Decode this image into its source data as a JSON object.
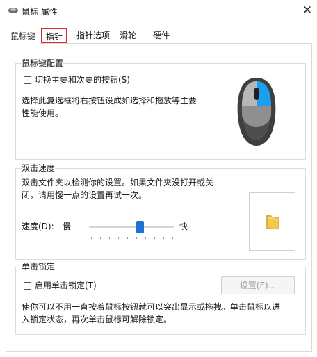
{
  "window": {
    "title": "鼠标 属性"
  },
  "tabs": [
    {
      "label": "鼠标键",
      "active": true
    },
    {
      "label": "指针",
      "highlighted": true
    },
    {
      "label": "指针选项"
    },
    {
      "label": "滑轮"
    },
    {
      "label": "硬件"
    }
  ],
  "button_config": {
    "title": "鼠标键配置",
    "switch_label": "切换主要和次要的按钮(S)",
    "switch_checked": false,
    "description_line1": "选择此复选框将右按钮设成如选择和拖放等主要",
    "description_line2": "性能使用。"
  },
  "double_click": {
    "title": "双击速度",
    "description_line1": "双击文件夹以检测你的设置。如果文件夹没打开或关",
    "description_line2": "闭，请用慢一点的设置再试一次。",
    "speed_label": "速度(D):",
    "slow_label": "慢",
    "fast_label": "快",
    "speed_value": 0.6
  },
  "click_lock": {
    "title": "单击锁定",
    "enable_label": "启用单击锁定(T)",
    "enable_checked": false,
    "settings_button": "设置(E)...",
    "description_line1": "使你可以不用一直按着鼠标按钮就可以突出显示或拖拽。单击鼠标以进",
    "description_line2": "入锁定状态，再次单击鼠标可解除锁定。"
  },
  "colors": {
    "accent": "#1f72d4",
    "highlight_border": "#e0262a",
    "folder": "#f1c84b"
  },
  "icons": {
    "title": "mouse-icon",
    "close": "close-icon",
    "folder": "folder-icon"
  }
}
